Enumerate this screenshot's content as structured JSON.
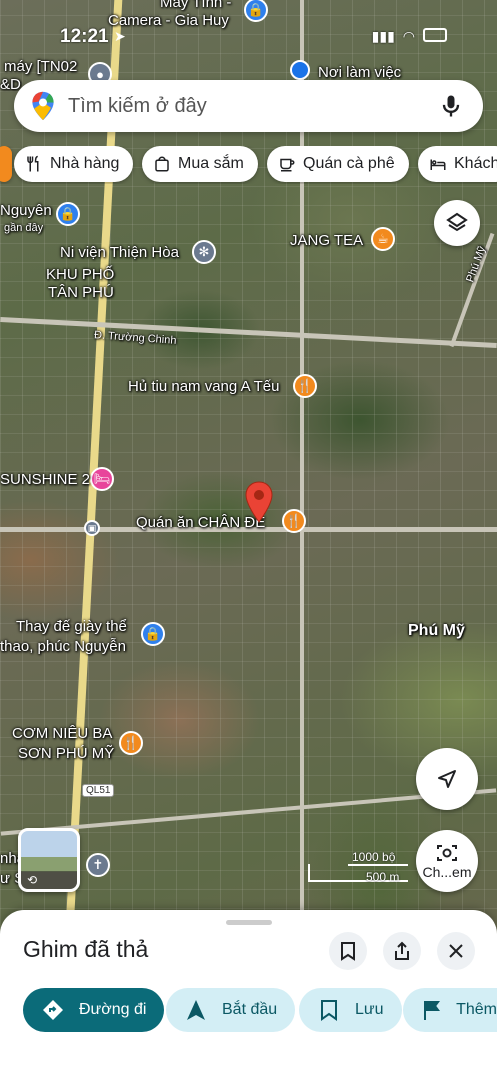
{
  "status_bar": {
    "time": "12:21"
  },
  "search": {
    "placeholder": "Tìm kiếm ở đây"
  },
  "chips": [
    {
      "label": "Nhà hàng",
      "icon": "restaurant-icon"
    },
    {
      "label": "Mua sắm",
      "icon": "shopping-bag-icon"
    },
    {
      "label": "Quán cà phê",
      "icon": "coffee-icon"
    },
    {
      "label": "Khách",
      "icon": "hotel-icon"
    }
  ],
  "map_labels": {
    "may_tinh": "Máy Tính -",
    "camera": "Camera - Gia Huy",
    "may_tn02": "máy [TN02",
    "bd": "&D",
    "noi_lam_viec": "Nơi làm việc",
    "nguyen": "Nguyên",
    "gan_day": "gần đây",
    "ni_vien": "Ni viện Thiện Hòa",
    "jang_tea": "JANG TEA",
    "khu_pho": "KHU PHỐ",
    "tan_phu": "TÂN PHÚ",
    "phu_my_road": "Phú Mỹ",
    "truong_chinh": "Đ. Trường Chinh",
    "hu_tiu": "Hủ tiu nam vang A Tếu",
    "sunshine": "SUNSHINE 2",
    "quan_an": "Quán ăn CHÂN ĐÊ",
    "thay_de_1": "Thay đế giày thể",
    "thay_de_2": "thao, phúc Nguyễn",
    "phu_my": "Phú Mỹ",
    "com_nieu_1": "CƠM NIÊU BA",
    "com_nieu_2": "SƠN PHÚ MỸ",
    "ql51": "QL51",
    "nha": "nhà",
    "u_s": "ư S",
    "scale_ft": "1000 bộ",
    "scale_m": "500 m",
    "chem": "Ch...em"
  },
  "sheet": {
    "title": "Ghim đã thả",
    "actions": [
      {
        "label": "Đường đi",
        "icon": "directions-icon"
      },
      {
        "label": "Bắt đầu",
        "icon": "navigation-arrow-icon"
      },
      {
        "label": "Lưu",
        "icon": "bookmark-icon"
      },
      {
        "label": "Thêm",
        "icon": "flag-icon"
      }
    ]
  },
  "colors": {
    "primary_teal": "#0b6b79",
    "secondary_teal_bg": "#d3eef5",
    "pin_red": "#ea4335",
    "poi_orange": "#f28a1e",
    "poi_blue": "#2f80ed"
  }
}
